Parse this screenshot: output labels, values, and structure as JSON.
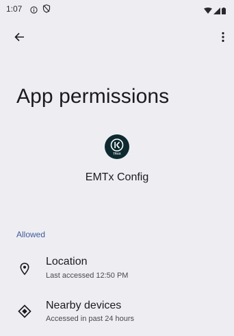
{
  "status_bar": {
    "time": "1:07"
  },
  "page": {
    "title": "App permissions"
  },
  "app": {
    "name": "EMTx Config",
    "icon_text": "TRAX",
    "icon_color": "#0e2a30"
  },
  "section": {
    "allowed_label": "Allowed"
  },
  "permissions": [
    {
      "title": "Location",
      "subtitle": "Last accessed 12:50 PM",
      "icon": "location-pin-icon"
    },
    {
      "title": "Nearby devices",
      "subtitle": "Accessed in past 24 hours",
      "icon": "nearby-devices-icon"
    }
  ],
  "colors": {
    "background": "#eeeef2",
    "accent": "#3d5a9c"
  }
}
